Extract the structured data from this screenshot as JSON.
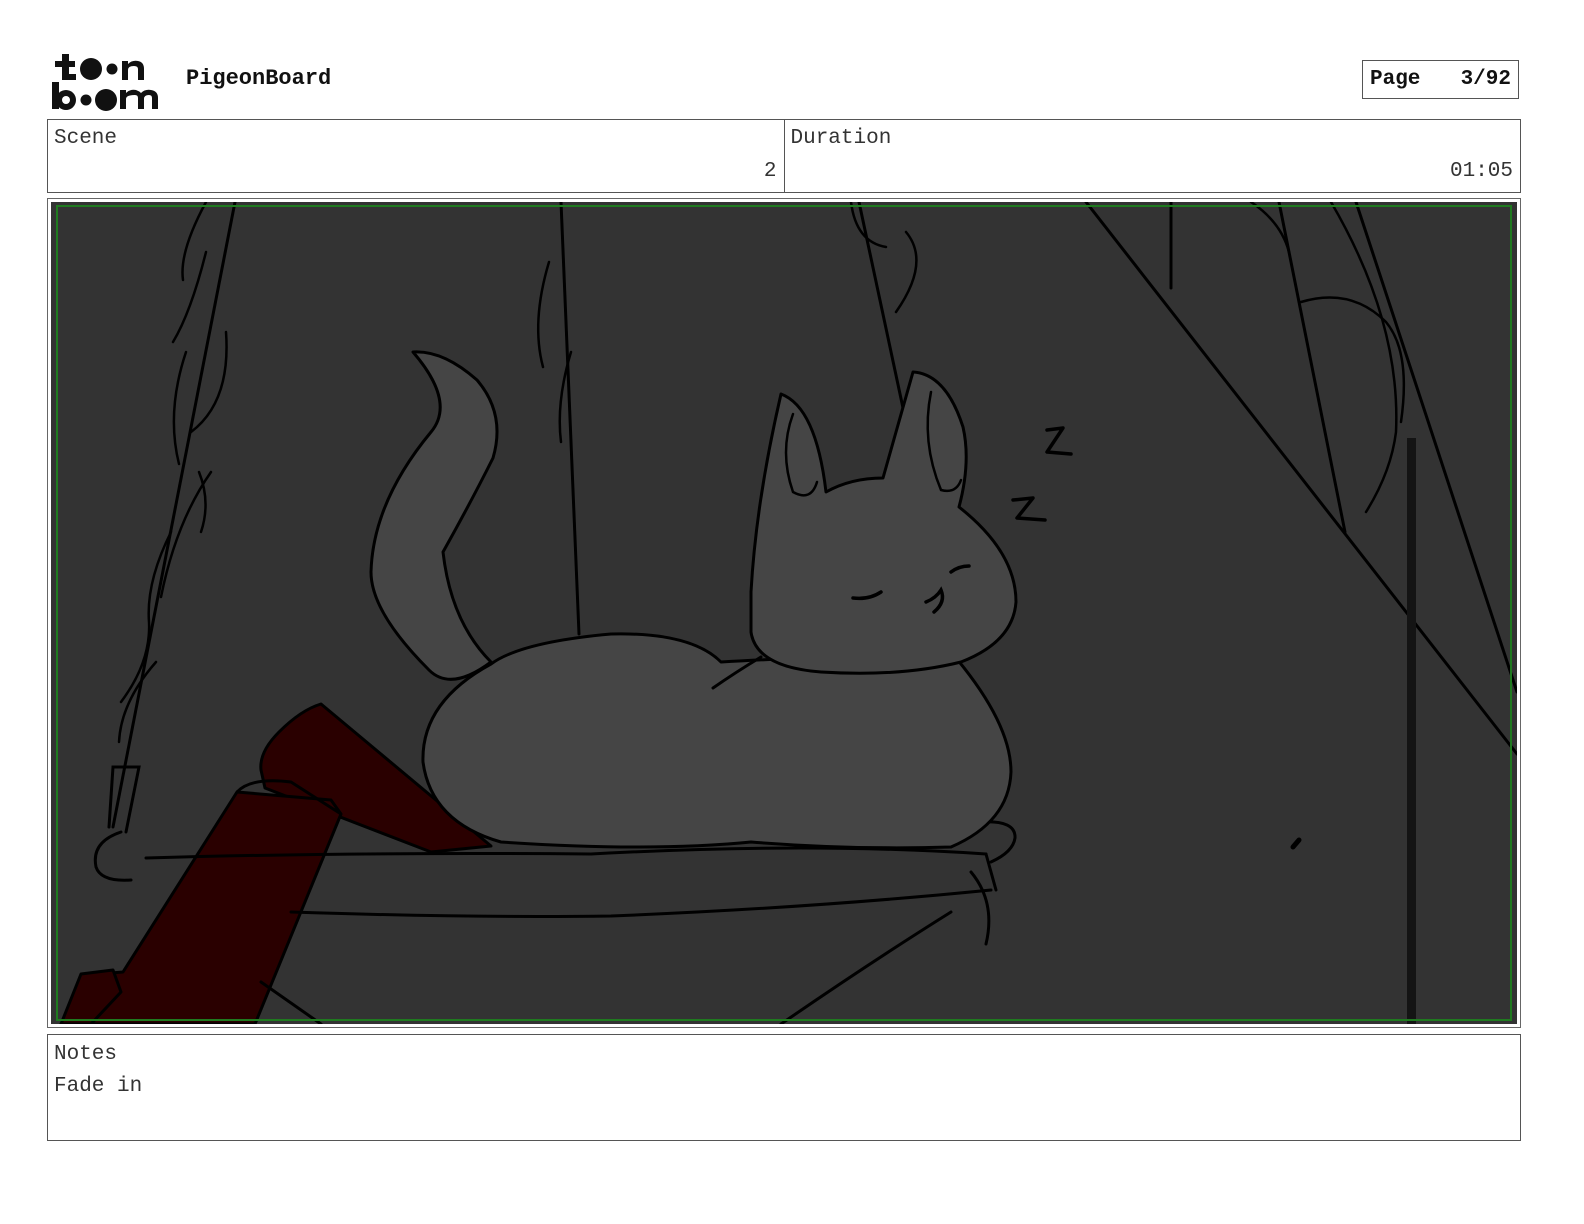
{
  "header": {
    "logo_text": "toon boom",
    "app_title": "PigeonBoard",
    "page_label": "Page",
    "page_number": "3/92"
  },
  "info": {
    "scene_label": "Scene",
    "scene_value": "2",
    "duration_label": "Duration",
    "duration_value": "01:05"
  },
  "panel": {
    "background_color": "#333333",
    "cat_color": "#454545",
    "red_prop_color": "#2a0000",
    "safe_frame_color": "#1f7a1f"
  },
  "notes": {
    "label": "Notes",
    "text": "Fade in"
  }
}
